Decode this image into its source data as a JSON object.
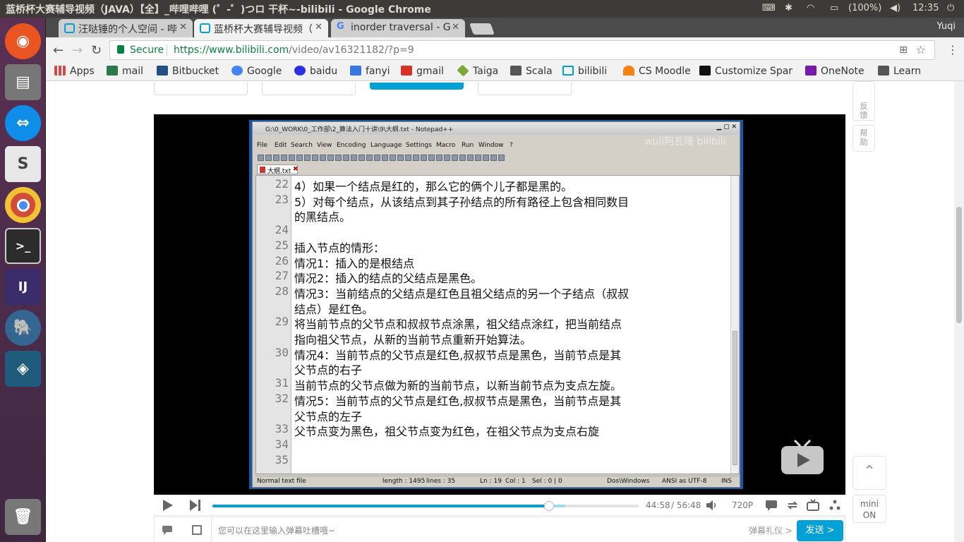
{
  "topbar": {
    "window_title": "蓝桥杯大赛辅导视频（JAVA）【全】_哔哩哔哩 (゜-゜)つロ 干杯~-bilibili - Google Chrome",
    "battery": "(100%)",
    "time": "12:35"
  },
  "tabs": [
    {
      "label": "汪哒锤的个人空间 - 哔",
      "active": false
    },
    {
      "label": "蓝桥杯大赛辅导视频（",
      "active": true
    },
    {
      "label": "inorder traversal - G",
      "active": false
    }
  ],
  "profile": "Yuqi",
  "omnibox": {
    "secure": "Secure",
    "url_host": "https://www.bilibili.com",
    "url_path": "/video/av16321182/?p=9"
  },
  "bookmarks": [
    "Apps",
    "mail",
    "Bitbucket",
    "Google",
    "baidu",
    "fanyi",
    "gmail",
    "Taiga",
    "Scala",
    "bilibili",
    "CS Moodle",
    "Customize Spar",
    "OneNote",
    "Learn"
  ],
  "notepad": {
    "title": "G:\\0_WORK\\0_工作部\\2_算法入门十讲\\9\\大纲.txt - Notepad++",
    "menu": [
      "File",
      "Edit",
      "Search",
      "View",
      "Encoding",
      "Language",
      "Settings",
      "Macro",
      "Run",
      "Window",
      "?"
    ],
    "tab": "大纲.txt",
    "watermark": "wuli阿瓦隆 bilibili",
    "lines": [
      {
        "n": "22",
        "t": "4）如果一个结点是红的，那么它的俩个儿子都是黑的。"
      },
      {
        "n": "23",
        "t": "5）对每个结点，从该结点到其子孙结点的所有路径上包含相同数目"
      },
      {
        "n": "",
        "t": "的黑结点。"
      },
      {
        "n": "24",
        "t": ""
      },
      {
        "n": "25",
        "t": "插入节点的情形："
      },
      {
        "n": "26",
        "t": "情况1：插入的是根结点"
      },
      {
        "n": "27",
        "t": "情况2：插入的结点的父结点是黑色。"
      },
      {
        "n": "28",
        "t": "情况3：当前结点的父结点是红色且祖父结点的另一个子结点（叔叔"
      },
      {
        "n": "",
        "t": "结点）是红色。"
      },
      {
        "n": "29",
        "t": "将当前节点的父节点和叔叔节点涂黑，祖父结点涂红，把当前结点"
      },
      {
        "n": "",
        "t": "指向祖父节点，从新的当前节点重新开始算法。"
      },
      {
        "n": "30",
        "t": "情况4：当前节点的父节点是红色,叔叔节点是黑色，当前节点是其"
      },
      {
        "n": "",
        "t": "父节点的右子"
      },
      {
        "n": "31",
        "t": "当前节点的父节点做为新的当前节点，以新当前节点为支点左旋。"
      },
      {
        "n": "32",
        "t": "情况5：当前节点的父节点是红色,叔叔节点是黑色，当前节点是其"
      },
      {
        "n": "",
        "t": "父节点的左子"
      },
      {
        "n": "33",
        "t": "父节点变为黑色，祖父节点变为红色，在祖父节点为支点右旋"
      },
      {
        "n": "34",
        "t": ""
      },
      {
        "n": "35",
        "t": ""
      }
    ],
    "status": {
      "mode": "Normal text file",
      "length": "length : 1495",
      "lines": "lines : 35",
      "ln": "Ln : 19",
      "col": "Col : 1",
      "sel": "Sel : 0 | 0",
      "eol": "Dos\\Windows",
      "enc": "ANSI as UTF-8",
      "ins": "INS"
    }
  },
  "player": {
    "current": "44:58",
    "total": "/ 56:48",
    "quality": "720P",
    "progress": 0.79,
    "buffered": 0.827
  },
  "danmaku": {
    "placeholder": "您可以在这里输入弹幕吐槽哦~",
    "etiquette": "弹幕礼仪 >",
    "send": "发送 >"
  },
  "side": {
    "feedback": "反馈",
    "help": "帮助",
    "mini": "mini",
    "on": "ON"
  },
  "colors": {
    "accent": "#00a1d6",
    "secure": "#0b8043"
  }
}
